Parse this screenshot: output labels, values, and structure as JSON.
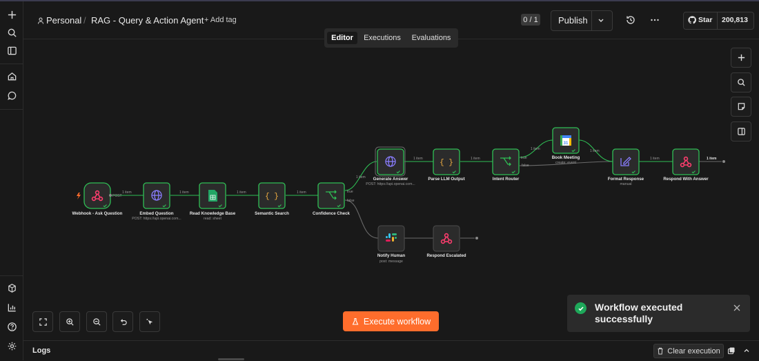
{
  "header": {
    "project": "Personal",
    "workflow_name": "RAG - Query & Action Agent",
    "add_tag": "+ Add tag",
    "counter": "0 / 1",
    "publish_label": "Publish",
    "github_star": "Star",
    "github_count": "200,813"
  },
  "tabs": [
    {
      "label": "Editor",
      "active": true
    },
    {
      "label": "Executions",
      "active": false
    },
    {
      "label": "Evaluations",
      "active": false
    }
  ],
  "nodes": {
    "webhook": {
      "label": "Webhook - Ask Question",
      "sub": ""
    },
    "embed": {
      "label": "Embed Question",
      "sub": "POST: https://api.openai.com..."
    },
    "read_kb": {
      "label": "Read Knowledge Base",
      "sub": "read: sheet"
    },
    "semantic": {
      "label": "Semantic Search",
      "sub": ""
    },
    "confidence": {
      "label": "Confidence Check",
      "sub": ""
    },
    "generate": {
      "label": "Generate Answer",
      "sub": "POST: https://api.openai.com..."
    },
    "parse": {
      "label": "Parse LLM Output",
      "sub": ""
    },
    "intent": {
      "label": "Intent Router",
      "sub": ""
    },
    "book": {
      "label": "Book Meeting",
      "sub": "create: event"
    },
    "format": {
      "label": "Format Response",
      "sub": "manual"
    },
    "respond": {
      "label": "Respond With Answer",
      "sub": ""
    },
    "notify": {
      "label": "Notify Human",
      "sub": "post: message"
    },
    "escalated": {
      "label": "Respond Escalated",
      "sub": ""
    }
  },
  "edges": {
    "item": "1 item",
    "post": "POST",
    "true": "true",
    "false": "false"
  },
  "execute_label": "Execute workflow",
  "toast": {
    "message": "Workflow executed successfully"
  },
  "logs": {
    "label": "Logs",
    "clear_label": "Clear execution"
  },
  "colors": {
    "accent": "#ff6d2c",
    "success": "#1ea85a",
    "node_ok": "#2fbf55",
    "webhook": "#ff3d6e"
  }
}
